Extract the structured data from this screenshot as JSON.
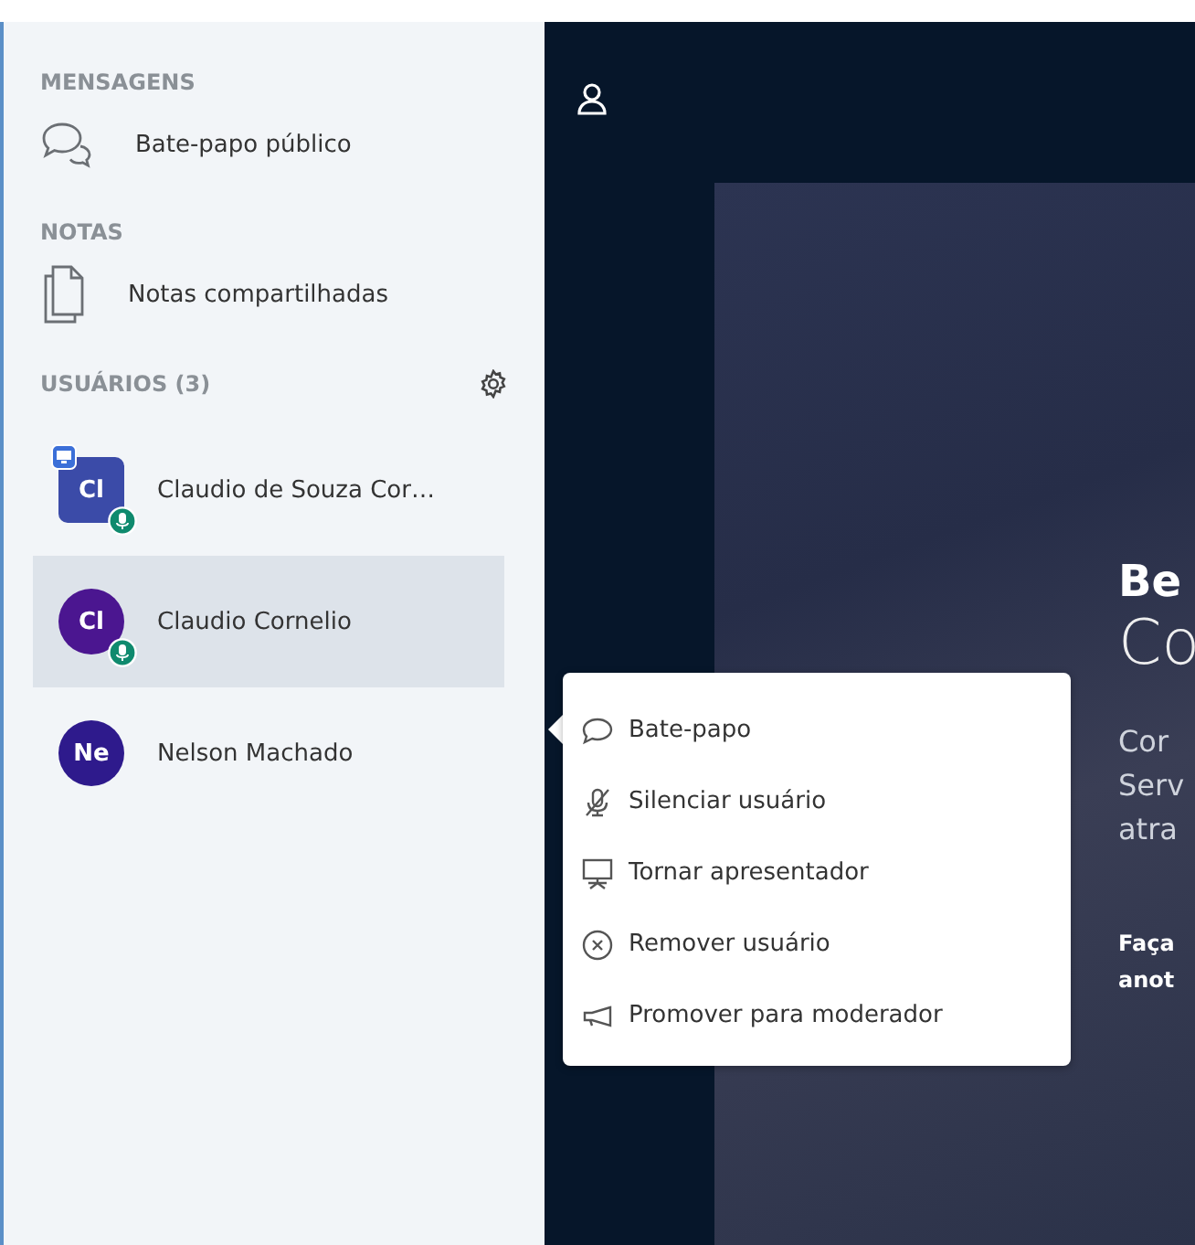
{
  "sidebar": {
    "sections": [
      {
        "title": "MENSAGENS",
        "items": [
          {
            "kind": "chat",
            "label": "Bate-papo público"
          }
        ]
      },
      {
        "title": "NOTAS",
        "items": [
          {
            "kind": "notes",
            "label": "Notas compartilhadas"
          }
        ]
      }
    ],
    "users_header": {
      "title": "USUÁRIOS (3)"
    },
    "users": [
      {
        "initials": "Cl",
        "name": "Claudio de Souza Cor…",
        "color": "#3b4ba8",
        "presenter": true,
        "voice": true,
        "selected": false
      },
      {
        "initials": "Cl",
        "name": "Claudio Cornelio",
        "color": "#4b1690",
        "presenter": false,
        "voice": true,
        "selected": true
      },
      {
        "initials": "Ne",
        "name": "Nelson Machado",
        "color": "#2e1a8c",
        "presenter": false,
        "voice": false,
        "selected": false
      }
    ]
  },
  "context_menu": {
    "items": [
      {
        "kind": "chat",
        "label": "Bate-papo"
      },
      {
        "kind": "mute",
        "label": "Silenciar usuário"
      },
      {
        "kind": "presenter",
        "label": "Tornar apresentador"
      },
      {
        "kind": "remove",
        "label": "Remover usuário"
      },
      {
        "kind": "promote",
        "label": "Promover para moderador"
      }
    ]
  },
  "slide": {
    "heading": "Be",
    "subheading": "Co",
    "paragraph": [
      "Cor",
      "Serv",
      "atra"
    ],
    "footer": [
      "Faça",
      "anot"
    ]
  }
}
